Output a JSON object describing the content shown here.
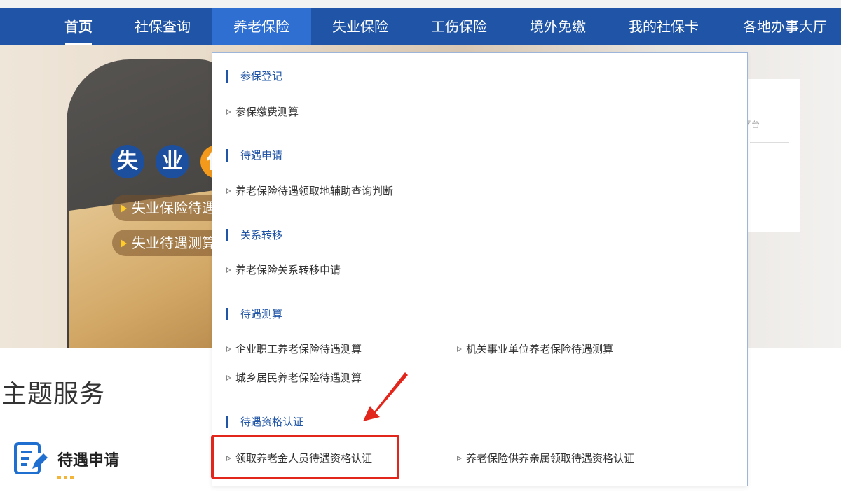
{
  "nav": {
    "items": [
      {
        "label": "首页"
      },
      {
        "label": "社保查询"
      },
      {
        "label": "养老保险"
      },
      {
        "label": "失业保险"
      },
      {
        "label": "工伤保险"
      },
      {
        "label": "境外免缴"
      },
      {
        "label": "我的社保卡"
      },
      {
        "label": "各地办事大厅"
      }
    ],
    "active_index": 2
  },
  "banner": {
    "chars": [
      "失",
      "业",
      "保"
    ],
    "pill1": "失业保险待遇",
    "pill2": "失业待遇测算",
    "side_text": "平台"
  },
  "dropdown": {
    "categories": [
      {
        "title": "参保登记",
        "links": [
          "参保缴费测算"
        ]
      },
      {
        "title": "待遇申请",
        "links": [
          "养老保险待遇领取地辅助查询判断"
        ]
      },
      {
        "title": "关系转移",
        "links": [
          "养老保险关系转移申请"
        ]
      },
      {
        "title": "待遇测算",
        "links": [
          "企业职工养老保险待遇测算",
          "机关事业单位养老保险待遇测算",
          "城乡居民养老保险待遇测算"
        ]
      },
      {
        "title": "待遇资格认证",
        "links": [
          "领取养老金人员待遇资格认证",
          "养老保险供养亲属领取待遇资格认证"
        ]
      }
    ]
  },
  "main": {
    "section_title": "主题服务",
    "service_label": "待遇申请"
  },
  "colors": {
    "nav_bg": "#1f54a6",
    "nav_active": "#2f6fd1",
    "accent_red": "#e3261c",
    "category_blue": "#1f54a6"
  },
  "icons": [
    "triangle-bullet-icon",
    "document-edit-icon",
    "red-arrow-icon"
  ]
}
